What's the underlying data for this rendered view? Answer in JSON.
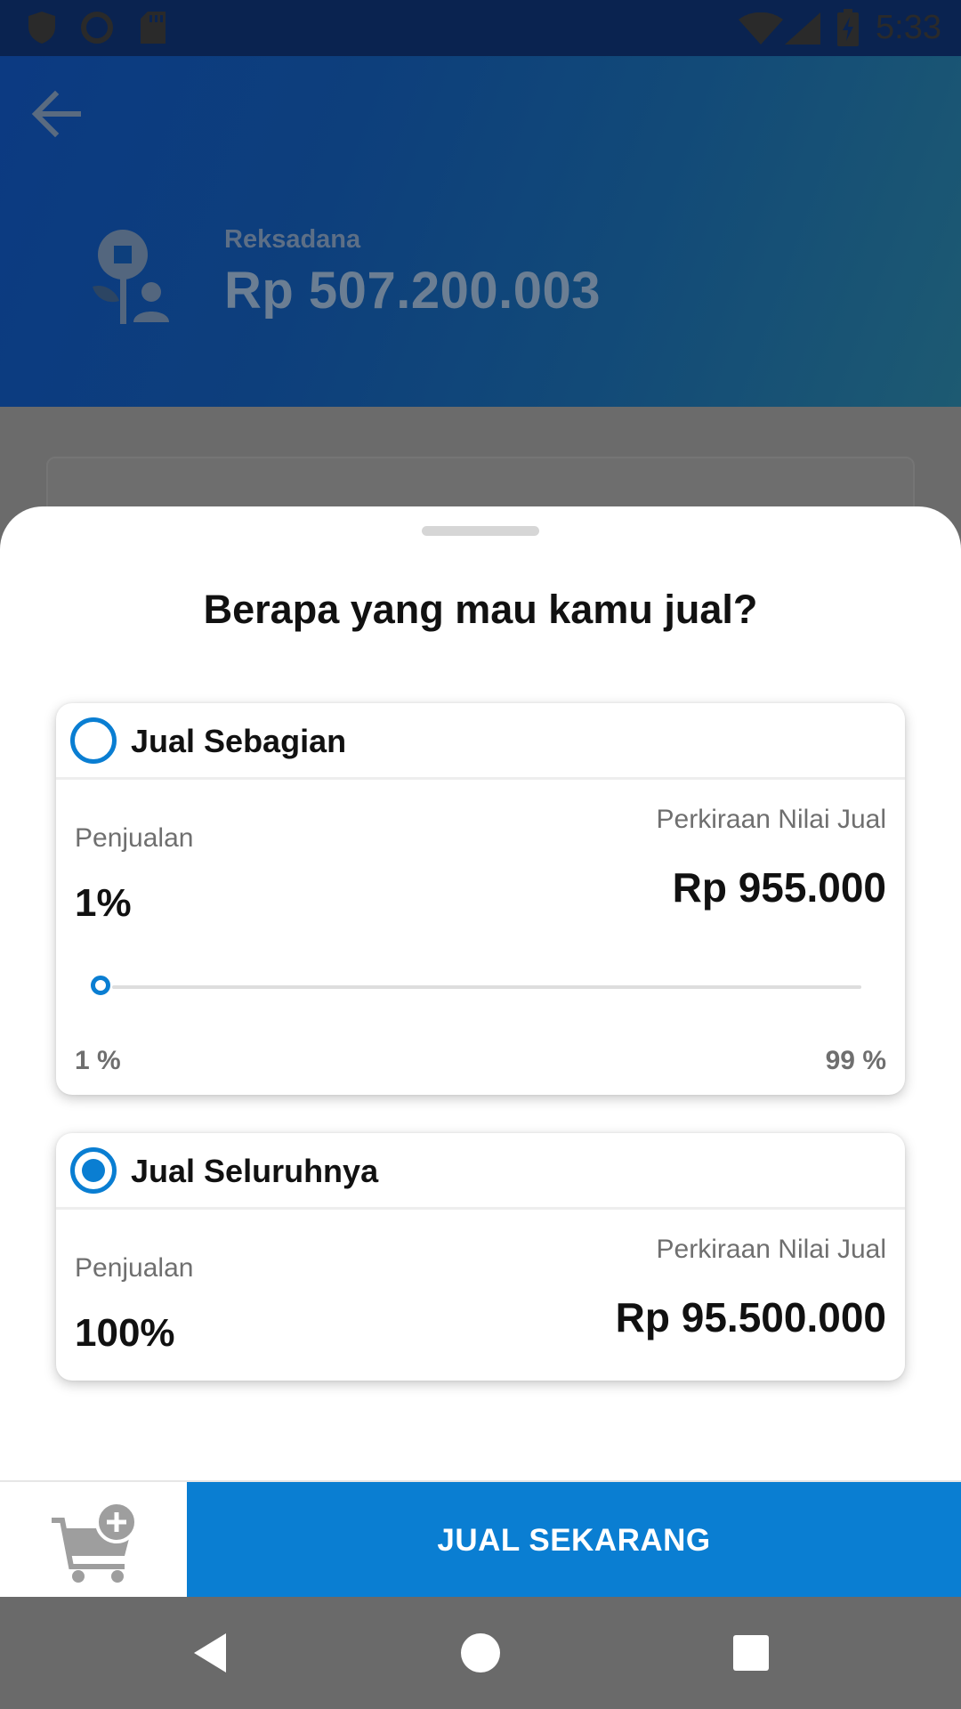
{
  "status_bar": {
    "time": "5:33",
    "icons": [
      "shield-icon",
      "circle-icon",
      "sd-card-icon",
      "wifi-icon",
      "signal-icon",
      "battery-charging-icon"
    ]
  },
  "header": {
    "back_icon": "arrow-left-icon",
    "category_label": "Reksadana",
    "amount": "Rp 507.200.003"
  },
  "sheet": {
    "title": "Berapa yang mau kamu jual?",
    "partial": {
      "title": "Jual Sebagian",
      "selected": false,
      "sale_label": "Penjualan",
      "sale_value": "1%",
      "estimate_label": "Perkiraan Nilai Jual",
      "estimate_value": "Rp 955.000",
      "slider_min_label": "1 %",
      "slider_max_label": "99 %",
      "slider_value": 1
    },
    "full": {
      "title": "Jual Seluruhnya",
      "selected": true,
      "sale_label": "Penjualan",
      "sale_value": "100%",
      "estimate_label": "Perkiraan Nilai Jual",
      "estimate_value": "Rp 95.500.000"
    }
  },
  "action_bar": {
    "cart_icon": "cart-plus-icon",
    "sell_label": "JUAL SEKARANG"
  },
  "nav_bar": {
    "icons": [
      "back-triangle-icon",
      "home-circle-icon",
      "recents-square-icon"
    ]
  },
  "colors": {
    "accent": "#0a7ed2",
    "header_dark": "#0c3a82"
  }
}
